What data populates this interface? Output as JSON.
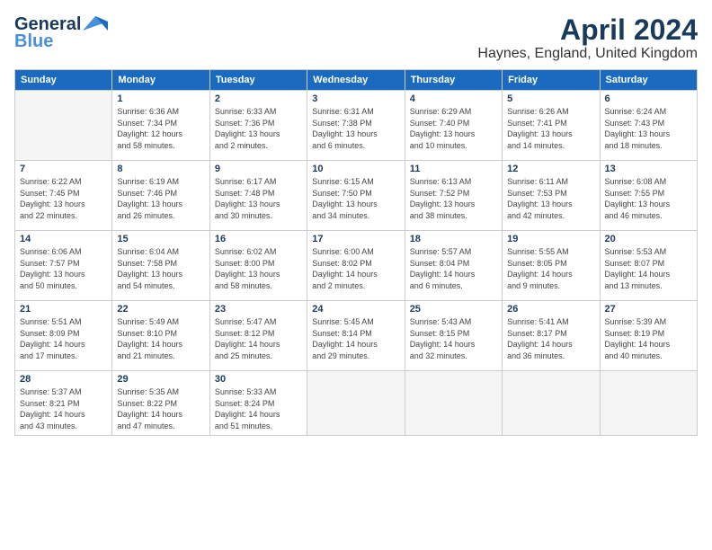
{
  "logo": {
    "line1": "General",
    "line2": "Blue"
  },
  "title": "April 2024",
  "subtitle": "Haynes, England, United Kingdom",
  "days": [
    "Sunday",
    "Monday",
    "Tuesday",
    "Wednesday",
    "Thursday",
    "Friday",
    "Saturday"
  ],
  "weeks": [
    [
      {
        "num": "",
        "info": ""
      },
      {
        "num": "1",
        "info": "Sunrise: 6:36 AM\nSunset: 7:34 PM\nDaylight: 12 hours\nand 58 minutes."
      },
      {
        "num": "2",
        "info": "Sunrise: 6:33 AM\nSunset: 7:36 PM\nDaylight: 13 hours\nand 2 minutes."
      },
      {
        "num": "3",
        "info": "Sunrise: 6:31 AM\nSunset: 7:38 PM\nDaylight: 13 hours\nand 6 minutes."
      },
      {
        "num": "4",
        "info": "Sunrise: 6:29 AM\nSunset: 7:40 PM\nDaylight: 13 hours\nand 10 minutes."
      },
      {
        "num": "5",
        "info": "Sunrise: 6:26 AM\nSunset: 7:41 PM\nDaylight: 13 hours\nand 14 minutes."
      },
      {
        "num": "6",
        "info": "Sunrise: 6:24 AM\nSunset: 7:43 PM\nDaylight: 13 hours\nand 18 minutes."
      }
    ],
    [
      {
        "num": "7",
        "info": "Sunrise: 6:22 AM\nSunset: 7:45 PM\nDaylight: 13 hours\nand 22 minutes."
      },
      {
        "num": "8",
        "info": "Sunrise: 6:19 AM\nSunset: 7:46 PM\nDaylight: 13 hours\nand 26 minutes."
      },
      {
        "num": "9",
        "info": "Sunrise: 6:17 AM\nSunset: 7:48 PM\nDaylight: 13 hours\nand 30 minutes."
      },
      {
        "num": "10",
        "info": "Sunrise: 6:15 AM\nSunset: 7:50 PM\nDaylight: 13 hours\nand 34 minutes."
      },
      {
        "num": "11",
        "info": "Sunrise: 6:13 AM\nSunset: 7:52 PM\nDaylight: 13 hours\nand 38 minutes."
      },
      {
        "num": "12",
        "info": "Sunrise: 6:11 AM\nSunset: 7:53 PM\nDaylight: 13 hours\nand 42 minutes."
      },
      {
        "num": "13",
        "info": "Sunrise: 6:08 AM\nSunset: 7:55 PM\nDaylight: 13 hours\nand 46 minutes."
      }
    ],
    [
      {
        "num": "14",
        "info": "Sunrise: 6:06 AM\nSunset: 7:57 PM\nDaylight: 13 hours\nand 50 minutes."
      },
      {
        "num": "15",
        "info": "Sunrise: 6:04 AM\nSunset: 7:58 PM\nDaylight: 13 hours\nand 54 minutes."
      },
      {
        "num": "16",
        "info": "Sunrise: 6:02 AM\nSunset: 8:00 PM\nDaylight: 13 hours\nand 58 minutes."
      },
      {
        "num": "17",
        "info": "Sunrise: 6:00 AM\nSunset: 8:02 PM\nDaylight: 14 hours\nand 2 minutes."
      },
      {
        "num": "18",
        "info": "Sunrise: 5:57 AM\nSunset: 8:04 PM\nDaylight: 14 hours\nand 6 minutes."
      },
      {
        "num": "19",
        "info": "Sunrise: 5:55 AM\nSunset: 8:05 PM\nDaylight: 14 hours\nand 9 minutes."
      },
      {
        "num": "20",
        "info": "Sunrise: 5:53 AM\nSunset: 8:07 PM\nDaylight: 14 hours\nand 13 minutes."
      }
    ],
    [
      {
        "num": "21",
        "info": "Sunrise: 5:51 AM\nSunset: 8:09 PM\nDaylight: 14 hours\nand 17 minutes."
      },
      {
        "num": "22",
        "info": "Sunrise: 5:49 AM\nSunset: 8:10 PM\nDaylight: 14 hours\nand 21 minutes."
      },
      {
        "num": "23",
        "info": "Sunrise: 5:47 AM\nSunset: 8:12 PM\nDaylight: 14 hours\nand 25 minutes."
      },
      {
        "num": "24",
        "info": "Sunrise: 5:45 AM\nSunset: 8:14 PM\nDaylight: 14 hours\nand 29 minutes."
      },
      {
        "num": "25",
        "info": "Sunrise: 5:43 AM\nSunset: 8:15 PM\nDaylight: 14 hours\nand 32 minutes."
      },
      {
        "num": "26",
        "info": "Sunrise: 5:41 AM\nSunset: 8:17 PM\nDaylight: 14 hours\nand 36 minutes."
      },
      {
        "num": "27",
        "info": "Sunrise: 5:39 AM\nSunset: 8:19 PM\nDaylight: 14 hours\nand 40 minutes."
      }
    ],
    [
      {
        "num": "28",
        "info": "Sunrise: 5:37 AM\nSunset: 8:21 PM\nDaylight: 14 hours\nand 43 minutes."
      },
      {
        "num": "29",
        "info": "Sunrise: 5:35 AM\nSunset: 8:22 PM\nDaylight: 14 hours\nand 47 minutes."
      },
      {
        "num": "30",
        "info": "Sunrise: 5:33 AM\nSunset: 8:24 PM\nDaylight: 14 hours\nand 51 minutes."
      },
      {
        "num": "",
        "info": ""
      },
      {
        "num": "",
        "info": ""
      },
      {
        "num": "",
        "info": ""
      },
      {
        "num": "",
        "info": ""
      }
    ]
  ]
}
